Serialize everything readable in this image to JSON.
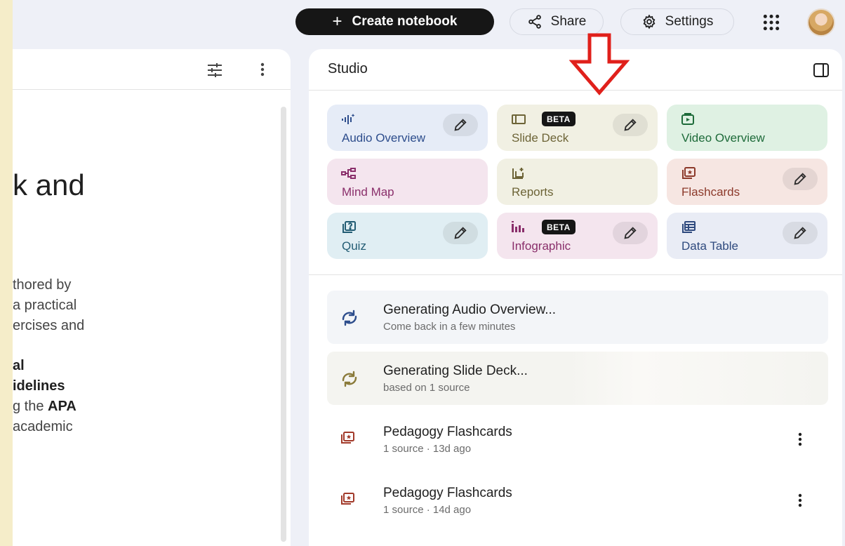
{
  "topbar": {
    "create_label": "Create notebook",
    "share_label": "Share",
    "settings_label": "Settings",
    "icons": {
      "create": "plus-icon",
      "share": "share-icon",
      "settings": "gear-icon",
      "apps": "apps-grid-icon",
      "avatar": "user-avatar"
    }
  },
  "left_panel": {
    "title_fragment": "k and",
    "lines": [
      "thored by",
      "a practical",
      "ercises and"
    ],
    "bold_line_1": "al",
    "bold_line_2": "idelines",
    "apa_prefix": "g the ",
    "apa_bold": "APA",
    "last_line": "academic",
    "icons": {
      "tune": "tune-icon",
      "more": "more-vert-icon"
    }
  },
  "studio": {
    "title": "Studio",
    "tiles": [
      {
        "label": "Audio Overview",
        "icon": "audio-waveform-icon",
        "color": "#e6ecf7",
        "fg": "#2d4d8c"
      },
      {
        "label": "Slide Deck",
        "badge": "BETA",
        "icon": "slides-icon",
        "color": "#f1f0e3",
        "fg": "#6d6437"
      },
      {
        "label": "Video Overview",
        "icon": "video-icon",
        "color": "#dff1e3",
        "fg": "#1e6b3a"
      },
      {
        "label": "Mind Map",
        "icon": "mind-map-icon",
        "color": "#f4e5ee",
        "fg": "#8a2f6b"
      },
      {
        "label": "Reports",
        "icon": "reports-icon",
        "color": "#f1f0e3",
        "fg": "#6d6437"
      },
      {
        "label": "Flashcards",
        "icon": "flashcards-icon",
        "color": "#f6e6e2",
        "fg": "#8c3a2b"
      },
      {
        "label": "Quiz",
        "icon": "quiz-icon",
        "color": "#e0eef3",
        "fg": "#235d74"
      },
      {
        "label": "Infographic",
        "badge": "BETA",
        "icon": "infographic-icon",
        "color": "#f4e5ee",
        "fg": "#8a2f6b"
      },
      {
        "label": "Data Table",
        "icon": "data-table-icon",
        "color": "#e9ecf5",
        "fg": "#2f4a7e"
      }
    ],
    "results": [
      {
        "title": "Generating Audio Overview...",
        "subtitle": "Come back in a few minutes",
        "icon": "sync-icon"
      },
      {
        "title": "Generating Slide Deck...",
        "subtitle": "based on 1 source",
        "icon": "sync-icon"
      },
      {
        "title": "Pedagogy Flashcards",
        "subtitle": "1 source · 13d ago",
        "icon": "flashcards-icon"
      },
      {
        "title": "Pedagogy Flashcards",
        "subtitle": "1 source · 14d ago",
        "icon": "flashcards-icon"
      }
    ]
  },
  "colors": {
    "annotation_arrow": "#e0201b",
    "primary_button": "#161616"
  }
}
